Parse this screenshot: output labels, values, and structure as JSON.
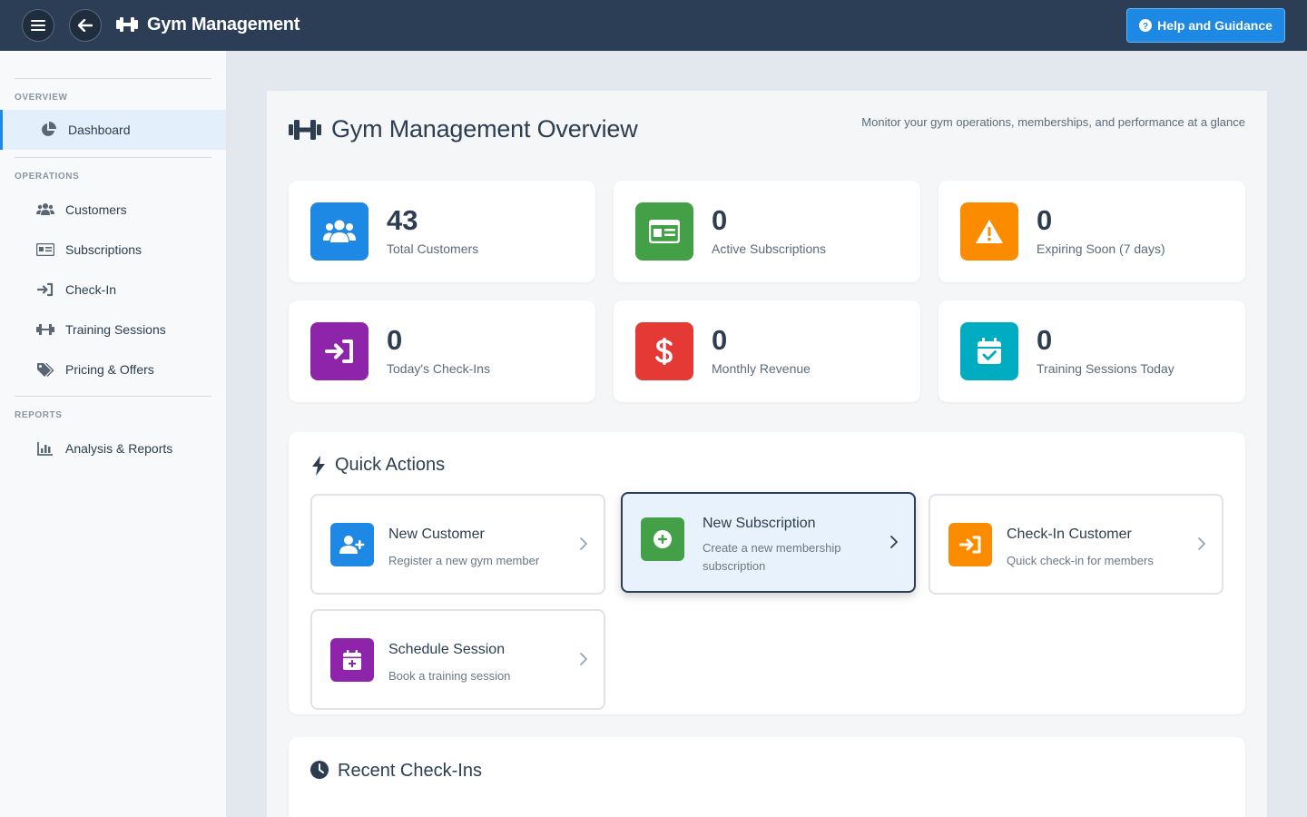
{
  "app": {
    "title": "Gym Management",
    "help_label": "Help and Guidance"
  },
  "sidebar": {
    "sections": [
      {
        "label": "OVERVIEW"
      },
      {
        "label": "OPERATIONS"
      },
      {
        "label": "REPORTS"
      }
    ],
    "items": [
      {
        "label": "Dashboard",
        "icon": "pie-chart-icon",
        "active": true
      },
      {
        "label": "Customers",
        "icon": "users-icon"
      },
      {
        "label": "Subscriptions",
        "icon": "id-card-icon"
      },
      {
        "label": "Check-In",
        "icon": "sign-in-icon"
      },
      {
        "label": "Training Sessions",
        "icon": "dumbbell-icon"
      },
      {
        "label": "Pricing & Offers",
        "icon": "tags-icon"
      },
      {
        "label": "Analysis & Reports",
        "icon": "bar-chart-icon"
      }
    ]
  },
  "page": {
    "title": "Gym Management Overview",
    "subtitle": "Monitor your gym operations, memberships, and performance at a glance"
  },
  "stats": [
    {
      "value": "43",
      "label": "Total Customers",
      "color": "#1e88e5",
      "icon": "users-icon"
    },
    {
      "value": "0",
      "label": "Active Subscriptions",
      "color": "#43a047",
      "icon": "id-card-icon"
    },
    {
      "value": "0",
      "label": "Expiring Soon (7 days)",
      "color": "#fb8c00",
      "icon": "warning-icon"
    },
    {
      "value": "0",
      "label": "Today's Check-Ins",
      "color": "#8e24aa",
      "icon": "sign-in-icon"
    },
    {
      "value": "0",
      "label": "Monthly Revenue",
      "color": "#e53935",
      "icon": "dollar-icon"
    },
    {
      "value": "0",
      "label": "Training Sessions Today",
      "color": "#00acc1",
      "icon": "calendar-check-icon"
    }
  ],
  "quick_actions": {
    "title": "Quick Actions",
    "items": [
      {
        "title": "New Customer",
        "desc": "Register a new gym member",
        "color": "#1e88e5",
        "icon": "user-plus-icon"
      },
      {
        "title": "New Subscription",
        "desc": "Create a new membership subscription",
        "color": "#43a047",
        "icon": "plus-circle-icon",
        "highlighted": true
      },
      {
        "title": "Check-In Customer",
        "desc": "Quick check-in for members",
        "color": "#fb8c00",
        "icon": "sign-in-icon"
      },
      {
        "title": "Schedule Session",
        "desc": "Book a training session",
        "color": "#8e24aa",
        "icon": "calendar-plus-icon"
      }
    ]
  },
  "recent": {
    "title": "Recent Check-Ins"
  }
}
